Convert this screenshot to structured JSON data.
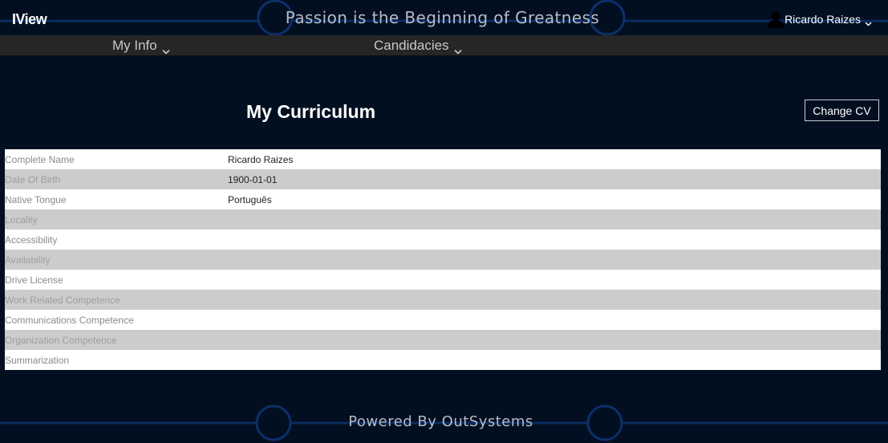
{
  "header": {
    "brand": "IView",
    "tagline": "Passion is the Beginning of Greatness",
    "user_name": "Ricardo Raizes"
  },
  "menu": {
    "items": [
      {
        "label": "My Info"
      },
      {
        "label": "Candidacies"
      }
    ]
  },
  "main": {
    "title": "My Curriculum",
    "change_cv_label": "Change CV"
  },
  "curriculum": {
    "rows": [
      {
        "label": "Complete Name",
        "value": "Ricardo Raizes"
      },
      {
        "label": "Date Of Birth",
        "value": "1900-01-01"
      },
      {
        "label": "Native Tongue",
        "value": "Português"
      },
      {
        "label": "Locality",
        "value": ""
      },
      {
        "label": "Accessibility",
        "value": ""
      },
      {
        "label": "Availability",
        "value": ""
      },
      {
        "label": "Drive License",
        "value": ""
      },
      {
        "label": "Work Related Competence",
        "value": ""
      },
      {
        "label": "Communications Competence",
        "value": ""
      },
      {
        "label": "Organization Competence",
        "value": ""
      },
      {
        "label": "Summarization",
        "value": ""
      }
    ]
  },
  "footer": {
    "text": "Powered By OutSystems"
  },
  "colors": {
    "background": "#020f21",
    "menubar": "#262626",
    "circuit": "#0d2f6a",
    "row_alt": "#cccccc"
  },
  "icons": {
    "user": "user-silhouette-icon",
    "dropdown": "chevron-down-icon"
  }
}
